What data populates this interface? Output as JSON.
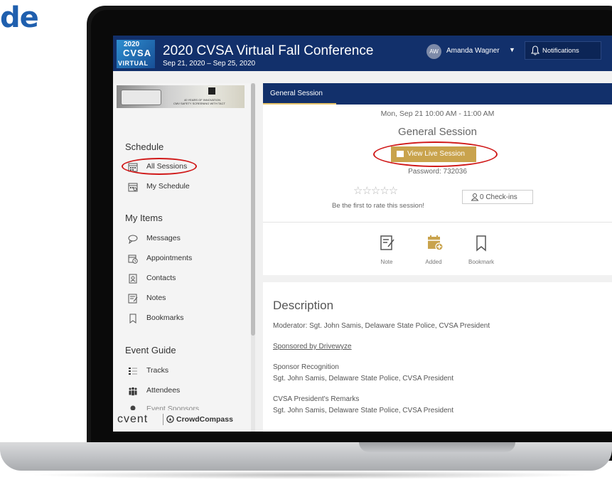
{
  "page_heading": "de",
  "app": {
    "logo": {
      "line1": "2020",
      "line2": "CVSA",
      "line3": "VIRTUAL"
    },
    "title": "2020 CVSA Virtual Fall Conference",
    "dates": "Sep 21, 2020 – Sep 25, 2020"
  },
  "user": {
    "initials": "AW",
    "name": "Amanda Wagner"
  },
  "notifications_label": "Notifications",
  "sidebar": {
    "banner": {
      "line1": "40 YEARS OF INNOVATION",
      "line2": "CMV SAFETY SCREENING WITH TACT"
    },
    "schedule": {
      "heading": "Schedule",
      "items": [
        {
          "label": "All Sessions",
          "icon": "calendar-grid-icon"
        },
        {
          "label": "My Schedule",
          "icon": "calendar-check-icon"
        }
      ]
    },
    "my_items": {
      "heading": "My Items",
      "items": [
        {
          "label": "Messages",
          "icon": "chat-icon"
        },
        {
          "label": "Appointments",
          "icon": "calendar-clock-icon"
        },
        {
          "label": "Contacts",
          "icon": "contact-card-icon"
        },
        {
          "label": "Notes",
          "icon": "note-icon"
        },
        {
          "label": "Bookmarks",
          "icon": "bookmark-icon"
        }
      ]
    },
    "event_guide": {
      "heading": "Event Guide",
      "items": [
        {
          "label": "Tracks",
          "icon": "tracks-icon"
        },
        {
          "label": "Attendees",
          "icon": "people-icon"
        },
        {
          "label": "Event Sponsors",
          "icon": "sponsor-icon"
        }
      ]
    },
    "brand": {
      "left": "cvent",
      "right": "CrowdCompass"
    }
  },
  "main": {
    "tab_label": "General Session",
    "session_time": "Mon, Sep 21 10:00 AM - 11:00 AM",
    "session_title": "General Session",
    "live_button": "View Live Session",
    "password": "Password: 732036",
    "rating_prompt": "Be the first to rate this session!",
    "checkins": "0 Check-ins",
    "actions": [
      {
        "label": "Note",
        "icon": "note-icon"
      },
      {
        "label": "Added",
        "icon": "calendar-added-icon"
      },
      {
        "label": "Bookmark",
        "icon": "bookmark-icon"
      }
    ],
    "description": {
      "heading": "Description",
      "moderator": "Moderator: Sgt. John Samis, Delaware State Police, CVSA President",
      "sponsored": "Sponsored by Drivewyze",
      "p1_title": "Sponsor Recognition",
      "p1_body": "Sgt. John Samis, Delaware State Police, CVSA President",
      "p2_title": "CVSA President's Remarks",
      "p2_body": "Sgt. John Samis, Delaware State Police, CVSA President"
    }
  },
  "colors": {
    "header": "#12306b",
    "accent": "#c9a34d",
    "highlight_ring": "#d01818",
    "heading_blue": "#1f5fae"
  }
}
